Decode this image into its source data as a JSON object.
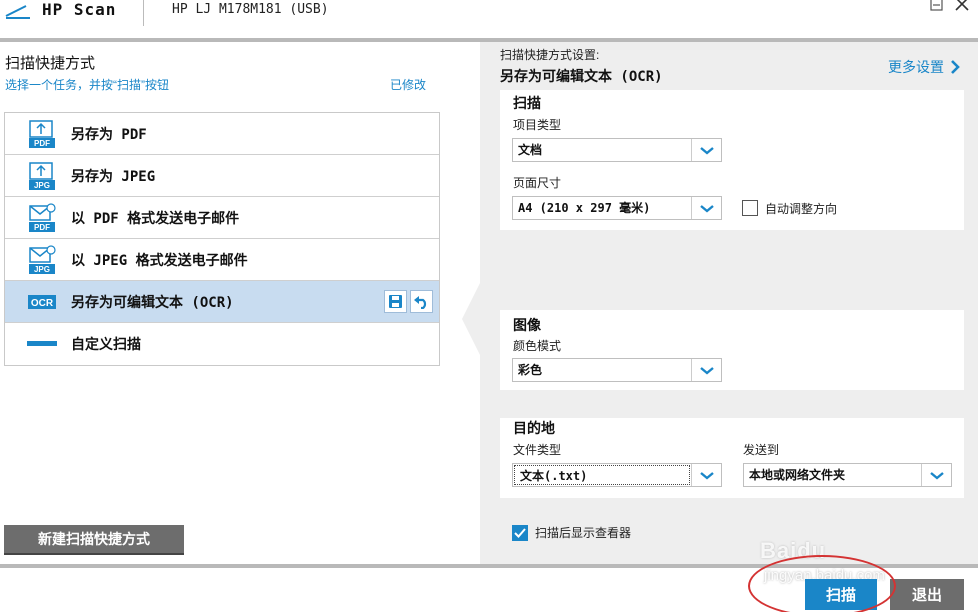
{
  "titlebar": {
    "app_name": "HP Scan",
    "device": "HP LJ M178M181 (USB)"
  },
  "left": {
    "title": "扫描快捷方式",
    "subtitle": "选择一个任务，并按“扫描”按钮",
    "modified": "已修改",
    "items": [
      {
        "label": "另存为 PDF",
        "icon": "pdf-save-icon"
      },
      {
        "label": "另存为 JPEG",
        "icon": "jpg-save-icon"
      },
      {
        "label": "以 PDF 格式发送电子邮件",
        "icon": "pdf-email-icon"
      },
      {
        "label": "以 JPEG 格式发送电子邮件",
        "icon": "jpg-email-icon"
      },
      {
        "label": "另存为可编辑文本 (OCR)",
        "icon": "ocr-icon"
      },
      {
        "label": "自定义扫描",
        "icon": "custom-scan-icon"
      }
    ],
    "new_shortcut": "新建扫描快捷方式"
  },
  "right": {
    "settings_label": "扫描快捷方式设置:",
    "shortcut_title": "另存为可编辑文本 (OCR)",
    "more_settings": "更多设置",
    "scan": {
      "title": "扫描",
      "item_type_label": "项目类型",
      "item_type_value": "文档",
      "page_size_label": "页面尺寸",
      "page_size_value": "A4 (210 x 297 毫米)",
      "auto_orient_label": "自动调整方向",
      "auto_orient_checked": false
    },
    "image": {
      "title": "图像",
      "color_mode_label": "颜色模式",
      "color_mode_value": "彩色"
    },
    "destination": {
      "title": "目的地",
      "file_type_label": "文件类型",
      "file_type_value": "文本(.txt)",
      "send_to_label": "发送到",
      "send_to_value": "本地或网络文件夹"
    },
    "show_viewer_label": "扫描后显示查看器",
    "show_viewer_checked": true
  },
  "footer": {
    "scan_button": "扫描",
    "exit_button": "退出"
  },
  "watermark": {
    "text": "Baidu",
    "url": "jingyan.baidu.com"
  },
  "colors": {
    "accent": "#1a86c8",
    "selected_row": "#c8dcf0",
    "panel_bg": "#eeeeee",
    "gray_button": "#6d6d6d",
    "annotation": "#d43333"
  }
}
